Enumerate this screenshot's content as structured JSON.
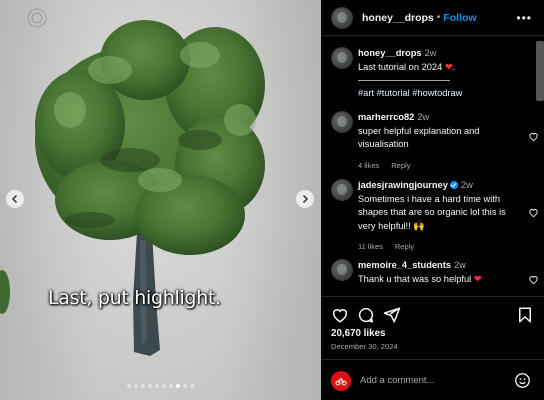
{
  "post": {
    "author": "honey__drops",
    "follow_label": "Follow",
    "separator": "•",
    "more_label": "•••",
    "caption_overlay": "Last, put highlight.",
    "carousel": {
      "total_slides": 10,
      "active_slide": 8
    }
  },
  "caption": {
    "user": "honey__drops",
    "time": "2w",
    "text": "Last tutorial on 2024",
    "tail": ".",
    "heart": "❤",
    "tags": "#art #tutorial #howtodraw"
  },
  "comments": [
    {
      "user": "marherrco82",
      "time": "2w",
      "text": "super helpful explanation and visualisation",
      "likes": "4 likes",
      "reply": "Reply",
      "verified": false
    },
    {
      "user": "jadesjrawingjourney",
      "time": "2w",
      "text": "Sometimes i have a hard time with shapes that are so organic lol this is very helpful!! 🙌",
      "likes": "11 likes",
      "reply": "Reply",
      "verified": true
    },
    {
      "user": "memoire_4_students",
      "time": "2w",
      "text": "Thank u that was so helpful",
      "heart": "❤",
      "verified": false
    }
  ],
  "footer": {
    "likes": "20,670 likes",
    "date": "December 30, 2024",
    "add_comment_placeholder": "Add a comment..."
  },
  "colors": {
    "accent": "#0095f6",
    "like_red": "#ff3040",
    "foliage": "#4e7a37",
    "trunk": "#3c4a4e"
  },
  "icons": [
    "like-icon",
    "comment-icon",
    "share-icon",
    "save-icon",
    "emoji-icon",
    "chevron-left-icon",
    "chevron-right-icon"
  ]
}
